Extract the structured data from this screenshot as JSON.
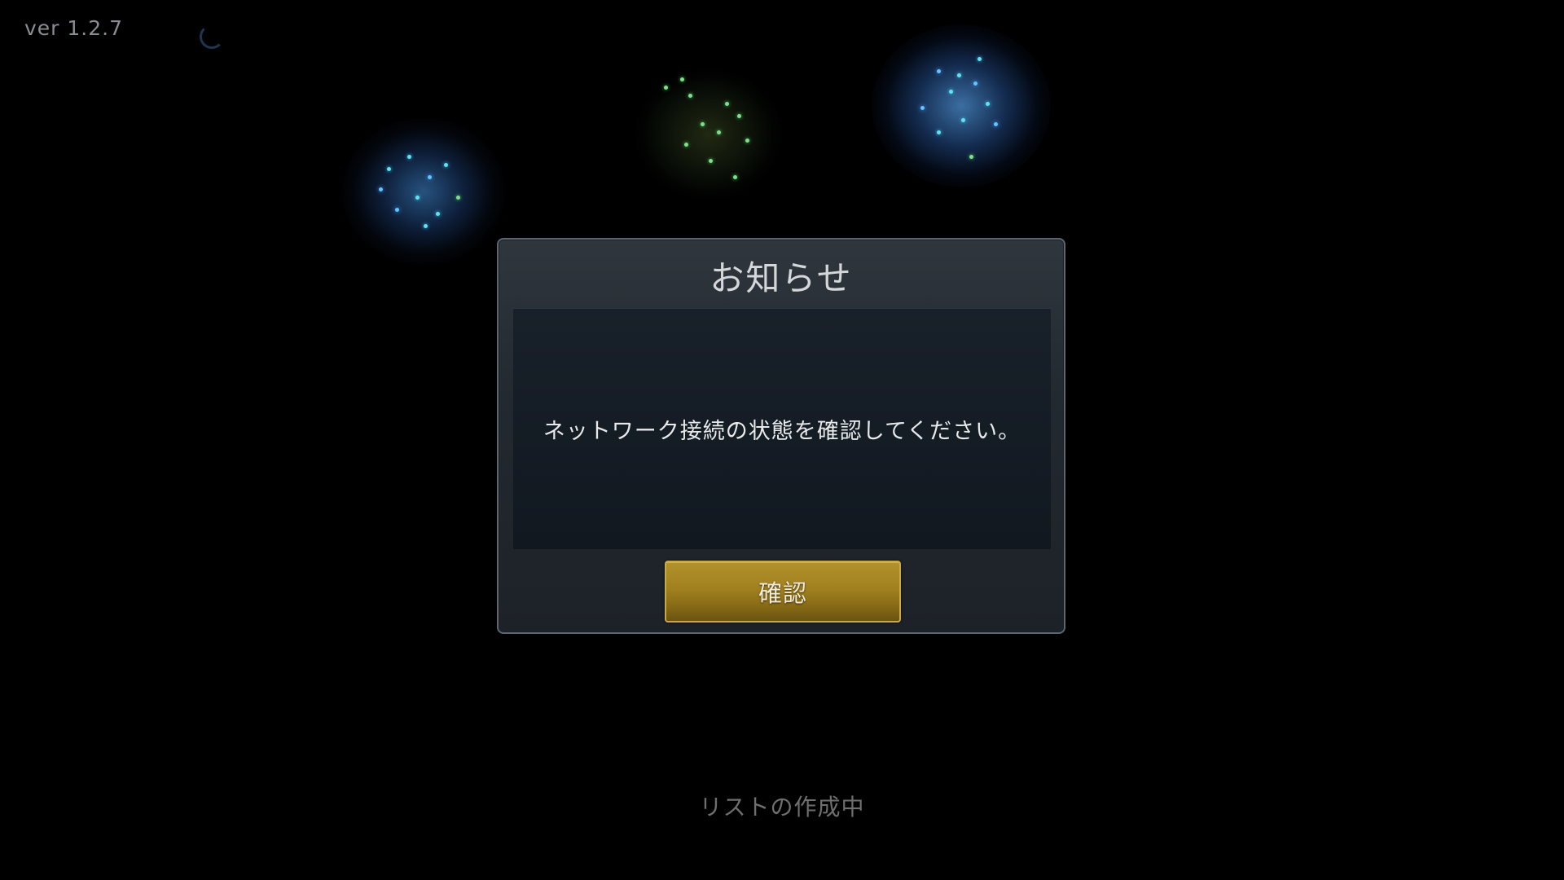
{
  "version_label": "ver 1.2.7",
  "dialog": {
    "title": "お知らせ",
    "message": "ネットワーク接続の状態を確認してください。",
    "confirm_label": "確認"
  },
  "status_text": "リストの作成中",
  "colors": {
    "background": "#000000",
    "dialog_border": "#5e6770",
    "confirm_button": "#a1801f",
    "firework_blue": "#4aa7ff",
    "firework_green": "#57c76a"
  },
  "icons": {
    "loading": "loading-spinner-icon"
  }
}
